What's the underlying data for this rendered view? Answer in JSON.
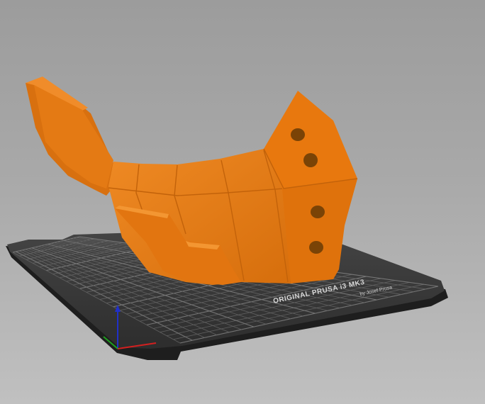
{
  "app": {
    "view": "3D viewport"
  },
  "bed": {
    "label_line1": "ORIGINAL PRUSA i3 MK3",
    "label_line2": "by Josef Prusa"
  },
  "colors": {
    "background_top": "#9c9c9c",
    "background_bottom": "#c0c0c0",
    "bed_surface": "#3a3a3a",
    "bed_edge": "#1e1e1e",
    "grid_line": "#6e6e6e",
    "model_base": "#e57a12",
    "model_dark": "#b85e08",
    "model_light": "#ef8a24",
    "axis_x": "#d22020",
    "axis_y": "#1ea01e",
    "axis_z": "#2030c8"
  },
  "icons": {
    "axes_gizmo": "xyz-axes-icon"
  }
}
